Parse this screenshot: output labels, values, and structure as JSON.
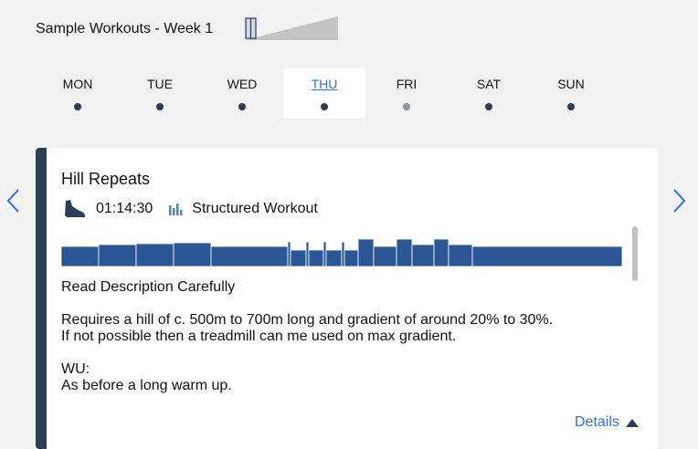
{
  "plan": {
    "title": "Sample Workouts - Week 1"
  },
  "days": [
    {
      "label": "MON",
      "active": false,
      "dot": "dark"
    },
    {
      "label": "TUE",
      "active": false,
      "dot": "dark"
    },
    {
      "label": "WED",
      "active": false,
      "dot": "dark"
    },
    {
      "label": "THU",
      "active": true,
      "dot": "dark"
    },
    {
      "label": "FRI",
      "active": false,
      "dot": "light"
    },
    {
      "label": "SAT",
      "active": false,
      "dot": "dark"
    },
    {
      "label": "SUN",
      "active": false,
      "dot": "dark"
    }
  ],
  "workout": {
    "title": "Hill Repeats",
    "duration": "01:14:30",
    "type": "Structured Workout",
    "description": [
      "Read Description Carefully",
      "Requires a hill of c. 500m to 700m long and gradient of around 20% to 30%.\nIf not possible then a treadmill can me used on max gradient.",
      "WU:\nAs before a long warm up."
    ],
    "details_label": "Details"
  },
  "colors": {
    "accent": "#2f6fdb",
    "card_accent": "#2b3f57",
    "profile_bar": "#2b5797"
  },
  "icons": {
    "duration": "shoe-icon",
    "type": "bar-chart-icon",
    "prev": "chevron-left-icon",
    "next": "chevron-right-icon",
    "details": "caret-up-icon"
  }
}
